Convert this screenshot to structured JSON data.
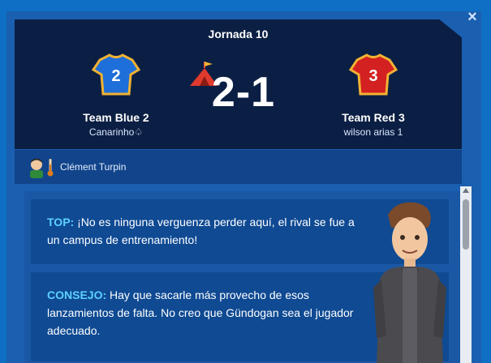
{
  "header": {
    "round_label": "Jornada  10",
    "score": "2-1",
    "home": {
      "name": "Team Blue 2",
      "manager": "Canarinho♤",
      "shirt_number": "2",
      "shirt_color": "#1e6fd9"
    },
    "away": {
      "name": "Team Red 3",
      "manager": "wilson arias 1",
      "shirt_number": "3",
      "shirt_color": "#d32020"
    }
  },
  "referee": {
    "name": "Clément Turpin"
  },
  "tips": [
    {
      "tag": "TOP:",
      "text": " ¡No es ninguna verguenza perder aquí, el rival se fue a un campus de entrenamiento!"
    },
    {
      "tag": "CONSEJO:",
      "text": " Hay que sacarle más provecho de esos lanzamientos de falta. No creo que Gündogan sea el jugador adecuado."
    }
  ],
  "icons": {
    "close": "close-icon",
    "tent": "tent-icon",
    "referee": "referee-avatar-icon",
    "thermometer": "thermometer-icon",
    "assistant": "assistant-character-icon"
  },
  "colors": {
    "header_bg": "#0b1f44",
    "panel_bg": "#1b5fb0",
    "tag": "#5cd1ff"
  }
}
